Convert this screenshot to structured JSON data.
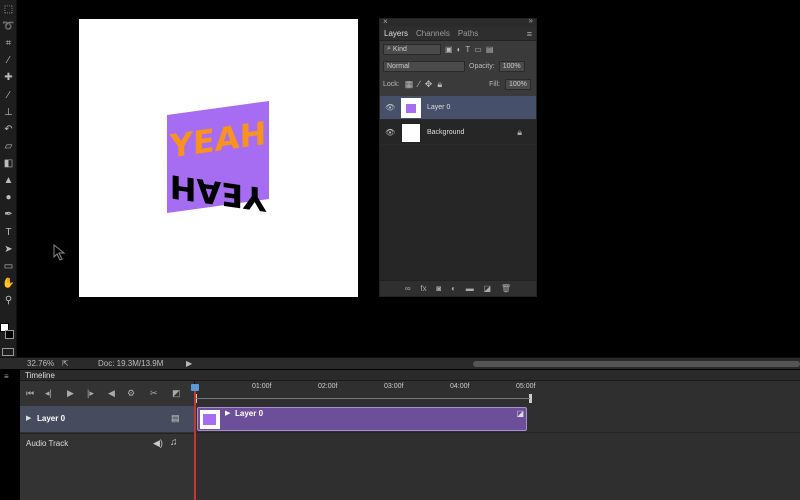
{
  "toolbar": {
    "tools": [
      "marquee-icon",
      "lasso-icon",
      "quick-select-icon",
      "crop-icon",
      "eyedropper-icon",
      "healing-icon",
      "brush-icon",
      "stamp-icon",
      "history-brush-icon",
      "eraser-icon",
      "gradient-icon",
      "blur-icon",
      "dodge-icon",
      "pen-icon",
      "type-icon",
      "path-select-icon",
      "shape-icon",
      "hand-icon",
      "zoom-icon"
    ],
    "type_glyph": "T"
  },
  "artwork": {
    "text_top": "YEAH",
    "text_bottom": "YEAH",
    "bg_color": "#a66cf2",
    "top_color": "#f7931e",
    "bottom_color": "#000000"
  },
  "layers_panel": {
    "tabs": [
      "Layers",
      "Channels",
      "Paths"
    ],
    "filter_label": "Kind",
    "blend_mode": "Normal",
    "opacity_label": "Opacity:",
    "opacity_value": "100%",
    "lock_label": "Lock:",
    "fill_label": "Fill:",
    "fill_value": "100%",
    "layers": [
      {
        "name": "Layer 0",
        "selected": true
      },
      {
        "name": "Background",
        "selected": false
      }
    ]
  },
  "status": {
    "zoom": "32.76%",
    "doc": "Doc: 19.3M/13.9M"
  },
  "timeline": {
    "title": "Timeline",
    "ruler": [
      "01:00f",
      "02:00f",
      "03:00f",
      "04:00f",
      "05:00f"
    ],
    "tracks": {
      "layer_label": "Layer 0",
      "clip_label": "Layer 0",
      "audio_label": "Audio Track"
    }
  }
}
